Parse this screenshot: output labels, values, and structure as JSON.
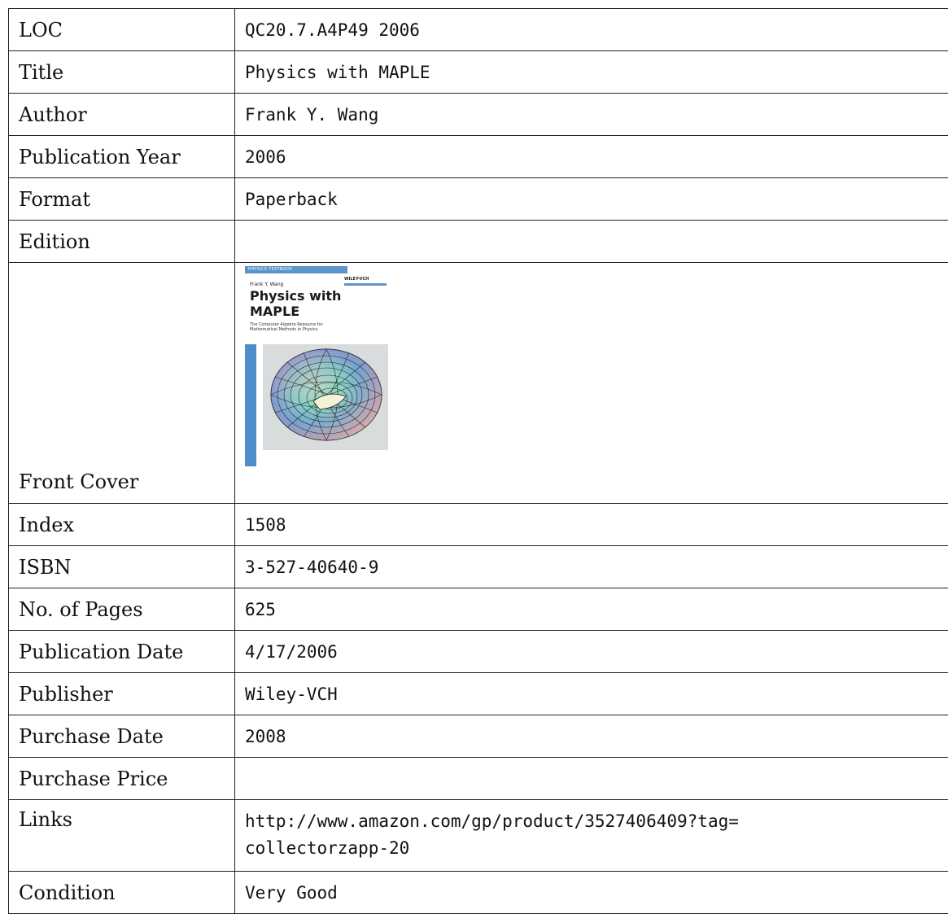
{
  "rows": [
    {
      "label": "LOC",
      "value": "QC20.7.A4P49 2006"
    },
    {
      "label": "Title",
      "value": "Physics with MAPLE"
    },
    {
      "label": "Author",
      "value": "Frank Y. Wang"
    },
    {
      "label": "Publication Year",
      "value": "2006"
    },
    {
      "label": "Format",
      "value": "Paperback"
    },
    {
      "label": "Edition",
      "value": ""
    },
    {
      "label": "Front Cover",
      "value": ""
    },
    {
      "label": "Index",
      "value": "1508"
    },
    {
      "label": "ISBN",
      "value": "3-527-40640-9"
    },
    {
      "label": "No. of Pages",
      "value": "625"
    },
    {
      "label": "Publication Date",
      "value": "4/17/2006"
    },
    {
      "label": "Publisher",
      "value": "Wiley-VCH"
    },
    {
      "label": "Purchase Date",
      "value": "2008"
    },
    {
      "label": "Purchase Price",
      "value": ""
    },
    {
      "label": "Links",
      "value": "http://www.amazon.com/gp/product/3527406409?tag=collectorzapp-20",
      "value_line1": "http://www.amazon.com/gp/product/3527406409?tag=",
      "value_line2": "collectorzapp-20"
    },
    {
      "label": "Condition",
      "value": "Very Good"
    }
  ],
  "cover": {
    "band_text": "PHYSICS TEXTBOOK",
    "publisher": "WILEY-VCH",
    "author": "Frank Y. Wang",
    "title_line1": "Physics with",
    "title_line2": "MAPLE",
    "subtitle_line1": "The Computer Algebra Resource for",
    "subtitle_line2": "Mathematical Methods in Physics",
    "icon": "torus-surface-plot",
    "accent_color": "#5b95c9"
  }
}
